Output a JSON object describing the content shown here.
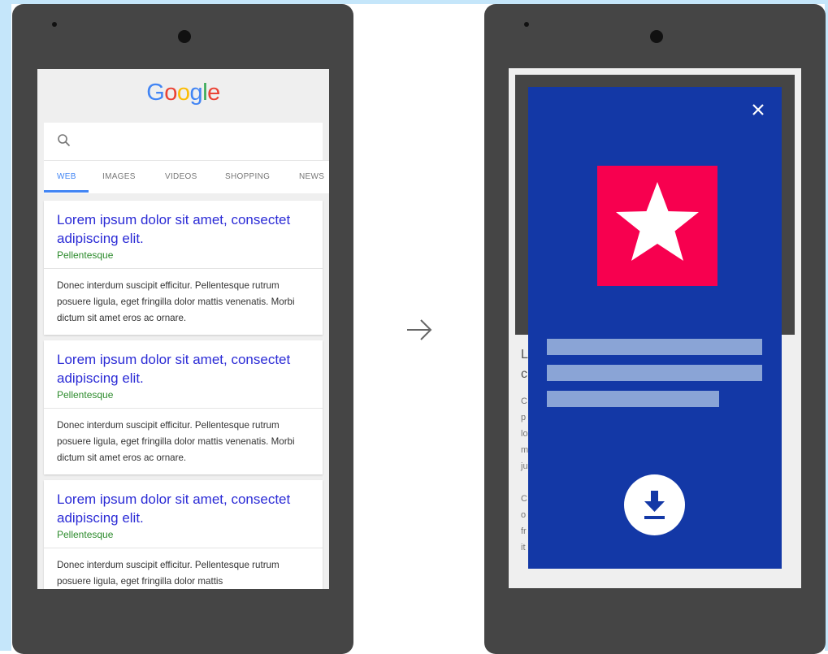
{
  "left_screen": {
    "logo": [
      "G",
      "o",
      "o",
      "g",
      "l",
      "e"
    ],
    "logo_colors": [
      "#4285f4",
      "#ea4335",
      "#fbbc05",
      "#4285f4",
      "#34a853",
      "#ea4335"
    ],
    "search": {
      "placeholder": ""
    },
    "tabs": [
      {
        "label": "WEB",
        "active": true
      },
      {
        "label": "IMAGES",
        "active": false
      },
      {
        "label": "VIDEOS",
        "active": false
      },
      {
        "label": "SHOPPING",
        "active": false
      },
      {
        "label": "NEWS",
        "active": false
      }
    ],
    "results": [
      {
        "title": "Lorem ipsum dolor sit amet, consectet adipiscing elit.",
        "site": "Pellentesque",
        "snippet": "Donec interdum suscipit efficitur. Pellentesque rutrum posuere ligula, eget fringilla dolor mattis venenatis. Morbi dictum sit amet eros ac ornare."
      },
      {
        "title": "Lorem ipsum dolor sit amet, consectet adipiscing elit.",
        "site": "Pellentesque",
        "snippet": "Donec interdum suscipit efficitur. Pellentesque rutrum posuere ligula, eget fringilla dolor mattis venenatis. Morbi dictum sit amet eros ac ornare."
      },
      {
        "title": "Lorem ipsum dolor sit amet, consectet adipiscing elit.",
        "site": "Pellentesque",
        "snippet": "Donec interdum suscipit efficitur. Pellentesque rutrum posuere ligula, eget fringilla dolor mattis"
      }
    ]
  },
  "right_screen": {
    "peek_letters": [
      "L",
      "c",
      "C",
      "p",
      "lo",
      "m",
      "ju",
      "C",
      "o",
      "fr",
      "it"
    ],
    "modal": {
      "close_icon": "close-icon",
      "app_icon": "star-icon",
      "app_icon_color": "#f7004f",
      "background_color": "#1338a6",
      "download_icon": "download-icon"
    }
  },
  "arrow_icon": "arrow-right-icon"
}
